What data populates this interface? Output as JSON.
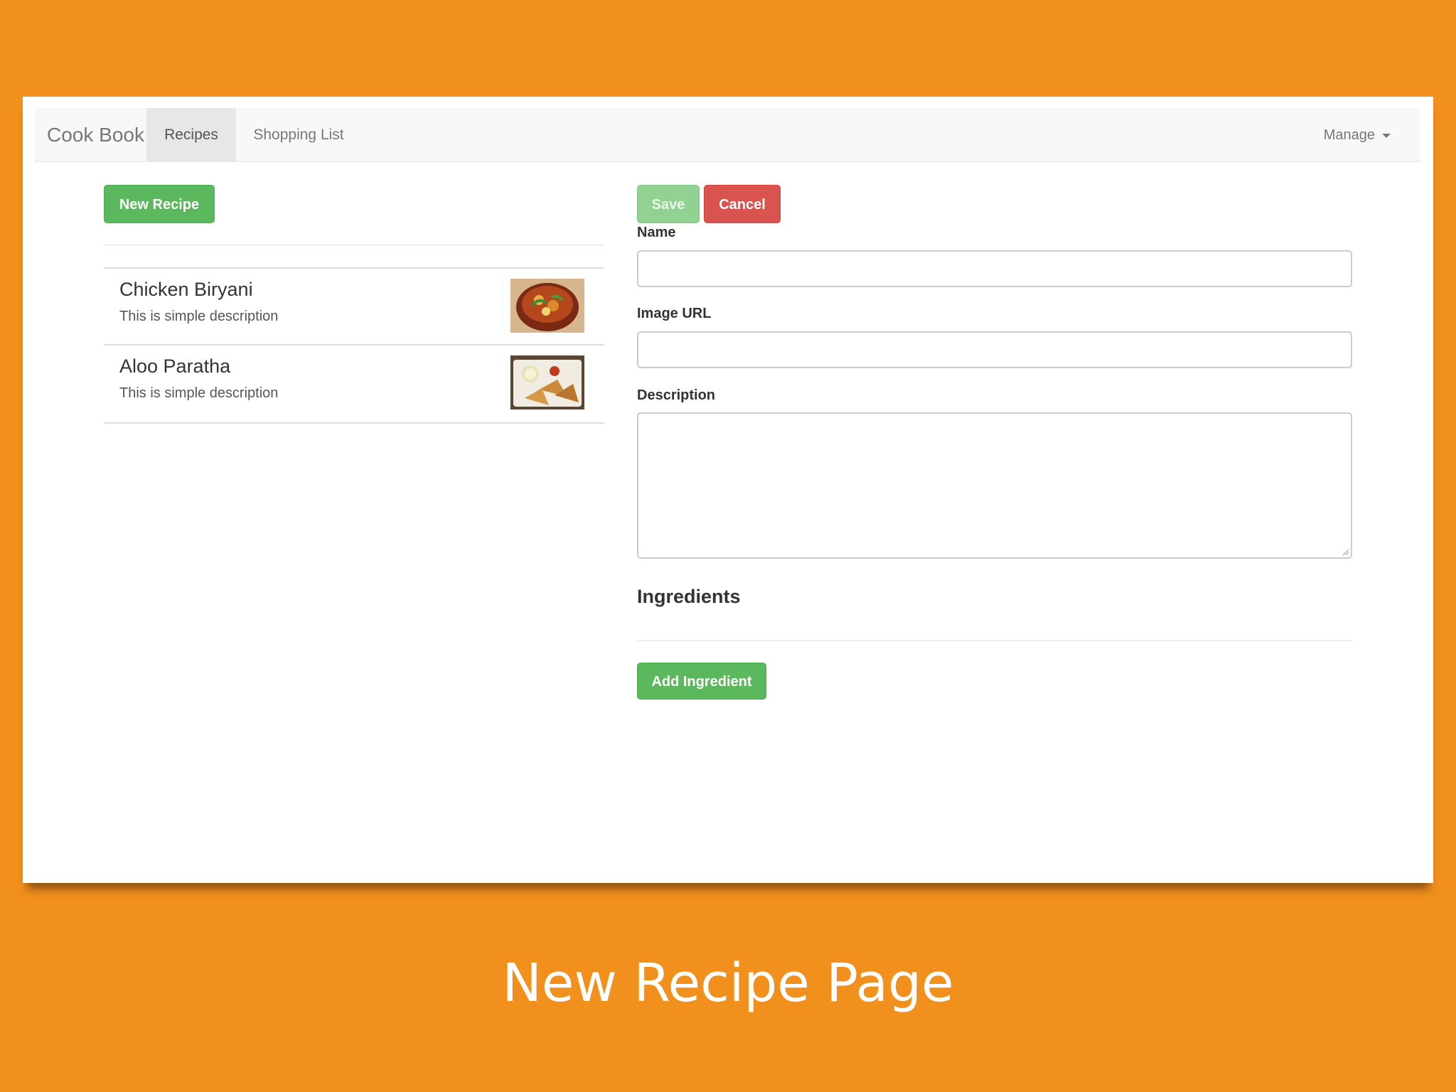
{
  "navbar": {
    "brand": "Cook Book",
    "tabs": [
      {
        "label": "Recipes",
        "active": true
      },
      {
        "label": "Shopping List",
        "active": false
      }
    ],
    "manage_label": "Manage"
  },
  "recipe_list": {
    "new_button": "New Recipe",
    "items": [
      {
        "name": "Chicken Biryani",
        "description": "This is simple description",
        "thumbnail": "biryani-photo"
      },
      {
        "name": "Aloo Paratha",
        "description": "This is simple description",
        "thumbnail": "paratha-photo"
      }
    ]
  },
  "form": {
    "save_label": "Save",
    "cancel_label": "Cancel",
    "name_label": "Name",
    "name_value": "",
    "image_url_label": "Image URL",
    "image_url_value": "",
    "description_label": "Description",
    "description_value": "",
    "ingredients_title": "Ingredients",
    "add_ingredient_label": "Add Ingredient"
  },
  "caption": "New Recipe Page",
  "colors": {
    "background": "#f2901e",
    "success": "#5cb85c",
    "danger": "#d9534f"
  }
}
